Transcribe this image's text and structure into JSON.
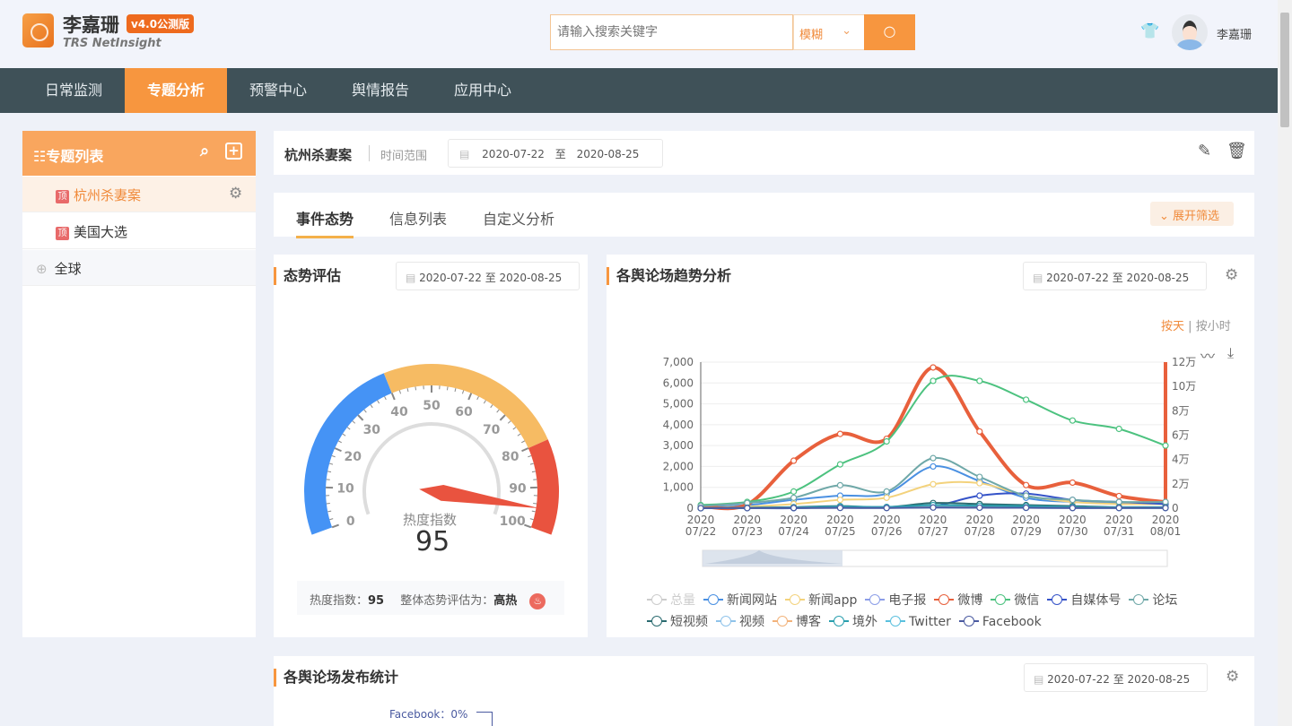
{
  "header": {
    "brand": "李嘉珊",
    "version": "v4.0公测版",
    "subtitle": "TRS NetInsight",
    "search_placeholder": "请输入搜索关键字",
    "mode": "模糊",
    "user": "李嘉珊"
  },
  "nav": [
    {
      "label": "日常监测"
    },
    {
      "label": "专题分析",
      "active": true
    },
    {
      "label": "预警中心"
    },
    {
      "label": "舆情报告"
    },
    {
      "label": "应用中心"
    }
  ],
  "sidebar": {
    "title": "专题列表",
    "items": [
      {
        "tag": "顶",
        "label": "杭州杀妻案",
        "active": true
      },
      {
        "tag": "顶",
        "label": "美国大选"
      }
    ],
    "group": "全球"
  },
  "topbar": {
    "title": "杭州杀妻案",
    "range_label": "时间范围",
    "start": "2020-07-22",
    "sep": "至",
    "end": "2020-08-25"
  },
  "tabs": [
    {
      "label": "事件态势",
      "active": true
    },
    {
      "label": "信息列表"
    },
    {
      "label": "自定义分析"
    }
  ],
  "filter_button": "展开筛选",
  "gauge_panel": {
    "title": "态势评估",
    "date_range": "2020-07-22 至 2020-08-25",
    "label": "热度指数",
    "value": 95,
    "summary_label": "热度指数：",
    "summary_value": "95",
    "eval_label": "整体态势评估为：",
    "eval_value": "高热",
    "colors": {
      "low": "#4593f5",
      "mid": "#f6bb63",
      "high": "#e9533f"
    },
    "bands": [
      40,
      80,
      100
    ],
    "ticks": [
      "0",
      "10",
      "20",
      "30",
      "40",
      "50",
      "60",
      "70",
      "80",
      "90",
      "100"
    ]
  },
  "trend_panel": {
    "title": "各舆论场趋势分析",
    "date_range": "2020-07-22 至 2020-08-25",
    "mode_day": "按天",
    "mode_sep": "|",
    "mode_hour": "按小时"
  },
  "chart_data": {
    "type": "line",
    "x": [
      [
        "2020",
        "07/22"
      ],
      [
        "2020",
        "07/23"
      ],
      [
        "2020",
        "07/24"
      ],
      [
        "2020",
        "07/25"
      ],
      [
        "2020",
        "07/26"
      ],
      [
        "2020",
        "07/27"
      ],
      [
        "2020",
        "07/28"
      ],
      [
        "2020",
        "07/29"
      ],
      [
        "2020",
        "07/30"
      ],
      [
        "2020",
        "07/31"
      ],
      [
        "2020",
        "08/01"
      ]
    ],
    "y_left": {
      "range": [
        0,
        7000
      ],
      "ticks": [
        "0",
        "1,000",
        "2,000",
        "3,000",
        "4,000",
        "5,000",
        "6,000",
        "7,000"
      ]
    },
    "y_right": {
      "range": [
        0,
        120000
      ],
      "ticks": [
        "0",
        "2万",
        "4万",
        "6万",
        "8万",
        "10万",
        "12万"
      ]
    },
    "grid": true,
    "legend_position": "bottom",
    "series": [
      {
        "name": "总量",
        "color": "#cccccc",
        "hidden": true,
        "values": []
      },
      {
        "name": "新闻网站",
        "color": "#4a90e2",
        "values": [
          50,
          150,
          400,
          600,
          700,
          2000,
          1300,
          500,
          300,
          250,
          250
        ]
      },
      {
        "name": "新闻app",
        "color": "#f3d27c",
        "values": [
          30,
          80,
          200,
          400,
          500,
          1150,
          1200,
          600,
          300,
          200,
          200
        ]
      },
      {
        "name": "电子报",
        "color": "#8c9ee8",
        "values": [
          0,
          10,
          20,
          30,
          20,
          40,
          30,
          20,
          10,
          10,
          10
        ]
      },
      {
        "name": "微博",
        "color": "#e8603c",
        "axis": "right",
        "values": [
          1500,
          3000,
          39000,
          61000,
          57000,
          115600,
          63000,
          19000,
          21000,
          10000,
          5000
        ]
      },
      {
        "name": "微信",
        "color": "#4cc27f",
        "values": [
          150,
          300,
          800,
          2100,
          3200,
          6100,
          6100,
          5200,
          4200,
          3800,
          3000
        ]
      },
      {
        "name": "自媒体号",
        "color": "#3553c8",
        "values": [
          0,
          0,
          0,
          50,
          50,
          100,
          600,
          700,
          400,
          300,
          200
        ]
      },
      {
        "name": "论坛",
        "color": "#6fa8a8",
        "values": [
          100,
          250,
          500,
          1100,
          800,
          2400,
          1500,
          600,
          400,
          300,
          300
        ]
      },
      {
        "name": "短视频",
        "color": "#2b6b70",
        "values": [
          0,
          20,
          50,
          100,
          50,
          250,
          200,
          150,
          100,
          50,
          50
        ]
      },
      {
        "name": "视频",
        "color": "#8fc3ea",
        "values": [
          0,
          10,
          30,
          50,
          40,
          100,
          80,
          60,
          40,
          30,
          30
        ]
      },
      {
        "name": "博客",
        "color": "#f2b27a",
        "values": [
          0,
          10,
          20,
          30,
          20,
          50,
          40,
          30,
          20,
          20,
          20
        ]
      },
      {
        "name": "境外",
        "color": "#2a9fae",
        "values": [
          0,
          20,
          40,
          80,
          60,
          150,
          120,
          100,
          60,
          40,
          30
        ]
      },
      {
        "name": "Twitter",
        "color": "#5bc0de",
        "values": [
          0,
          5,
          10,
          20,
          15,
          40,
          30,
          20,
          15,
          10,
          10
        ]
      },
      {
        "name": "Facebook",
        "color": "#4a5aa0",
        "values": [
          0,
          5,
          10,
          15,
          10,
          30,
          25,
          20,
          10,
          10,
          10
        ]
      }
    ]
  },
  "publish_panel": {
    "title": "各舆论场发布统计",
    "date_range": "2020-07-22 至 2020-08-25",
    "first_label": "Facebook：0%"
  }
}
